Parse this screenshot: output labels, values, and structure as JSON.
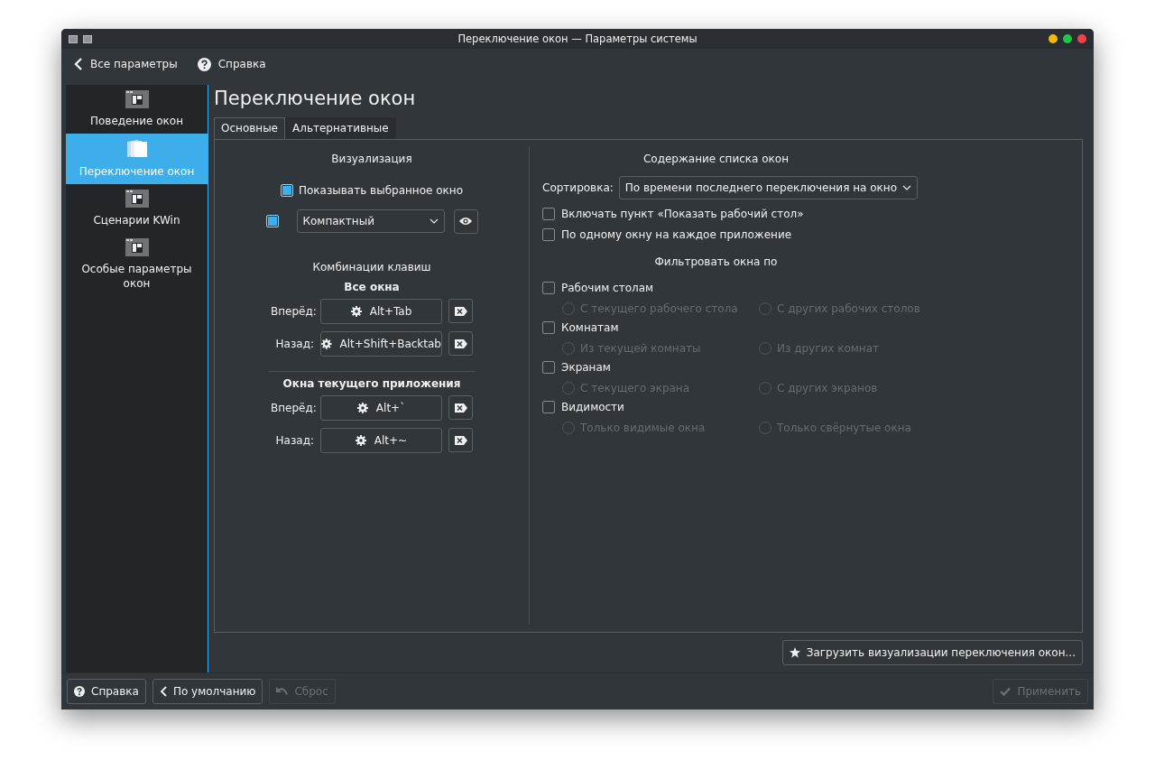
{
  "window": {
    "title": "Переключение окон — Параметры системы",
    "controls": [
      {
        "color": "#f5b70a"
      },
      {
        "color": "#1fc44a"
      },
      {
        "color": "#f0424b"
      }
    ]
  },
  "toolbar": {
    "back": "Все параметры",
    "help": "Справка"
  },
  "sidebar": {
    "items": [
      {
        "label": "Поведение окон",
        "selected": false,
        "kind": "window"
      },
      {
        "label": "Переключение окон",
        "selected": true,
        "kind": "stack"
      },
      {
        "label": "Сценарии KWin",
        "selected": false,
        "kind": "window"
      },
      {
        "label": "Особые параметры окон",
        "selected": false,
        "kind": "window"
      }
    ]
  },
  "page_title": "Переключение окон",
  "tabs": [
    {
      "label": "Основные",
      "selected": true
    },
    {
      "label": "Альтернативные",
      "selected": false
    }
  ],
  "visualization": {
    "heading": "Визуализация",
    "show_selected": {
      "label": "Показывать выбранное окно",
      "checked": true
    },
    "effect": {
      "checked": true,
      "value": "Компактный"
    }
  },
  "shortcuts": {
    "heading": "Комбинации клавиш",
    "groups": [
      {
        "title": "Все окна",
        "rows": [
          {
            "label": "Вперёд:",
            "shortcut": "Alt+Tab"
          },
          {
            "label": "Назад:",
            "shortcut": "Alt+Shift+Backtab"
          }
        ]
      },
      {
        "title": "Окна текущего приложения",
        "rows": [
          {
            "label": "Вперёд:",
            "shortcut": "Alt+`"
          },
          {
            "label": "Назад:",
            "shortcut": "Alt+~"
          }
        ]
      }
    ]
  },
  "list_content": {
    "heading": "Содержание списка окон",
    "sort": {
      "label": "Сортировка:",
      "value": "По времени последнего переключения на окно"
    },
    "options": [
      {
        "label": "Включать пункт «Показать рабочий стол»",
        "checked": false
      },
      {
        "label": "По одному окну на каждое приложение",
        "checked": false
      }
    ]
  },
  "filter": {
    "heading": "Фильтровать окна по",
    "items": [
      {
        "label": "Рабочим столам",
        "checked": false,
        "options": [
          {
            "label": "С текущего рабочего стола",
            "selected": false,
            "disabled": true
          },
          {
            "label": "С других рабочих столов",
            "selected": false,
            "disabled": true
          }
        ]
      },
      {
        "label": "Комнатам",
        "checked": false,
        "options": [
          {
            "label": "Из текущей комнаты",
            "selected": false,
            "disabled": true
          },
          {
            "label": "Из других комнат",
            "selected": false,
            "disabled": true
          }
        ]
      },
      {
        "label": "Экранам",
        "checked": false,
        "options": [
          {
            "label": "С текущего экрана",
            "selected": false,
            "disabled": true
          },
          {
            "label": "С других экранов",
            "selected": false,
            "disabled": true
          }
        ]
      },
      {
        "label": "Видимости",
        "checked": false,
        "options": [
          {
            "label": "Только видимые окна",
            "selected": false,
            "disabled": true
          },
          {
            "label": "Только свёрнутые окна",
            "selected": false,
            "disabled": true
          }
        ]
      }
    ]
  },
  "get_new": "Загрузить визуализации переключения окон...",
  "footer": {
    "left": [
      {
        "label": "Справка",
        "kind": "help",
        "disabled": false
      },
      {
        "label": "По умолчанию",
        "kind": "defaults",
        "disabled": false
      },
      {
        "label": "Сброс",
        "kind": "reset",
        "disabled": true
      }
    ],
    "right": [
      {
        "label": "Применить",
        "kind": "apply",
        "disabled": true
      }
    ]
  }
}
